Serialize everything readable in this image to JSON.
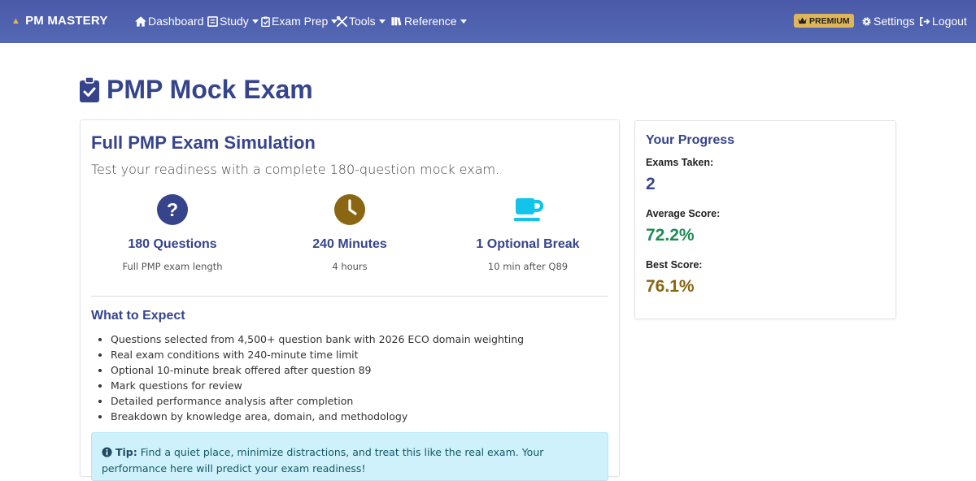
{
  "nav": {
    "brand": "PM MASTERY",
    "items": [
      {
        "label": "Dashboard",
        "icon": "home-icon",
        "dropdown": false
      },
      {
        "label": "Study",
        "icon": "book-icon",
        "dropdown": true
      },
      {
        "label": "Exam Prep",
        "icon": "clipboard-check-icon",
        "dropdown": true
      },
      {
        "label": "Tools",
        "icon": "tools-icon",
        "dropdown": true
      },
      {
        "label": "Reference",
        "icon": "books-icon",
        "dropdown": true
      }
    ],
    "premium": "PREMIUM",
    "settings": "Settings",
    "logout": "Logout"
  },
  "page": {
    "title": "PMP Mock Exam"
  },
  "main": {
    "title": "Full PMP Exam Simulation",
    "subtitle": "Test your readiness with a complete 180-question mock exam.",
    "stats": [
      {
        "icon": "question-circle-icon",
        "title": "180 Questions",
        "desc": "Full PMP exam length",
        "color": "#36448c"
      },
      {
        "icon": "clock-icon",
        "title": "240 Minutes",
        "desc": "4 hours",
        "color": "#8a6512"
      },
      {
        "icon": "coffee-icon",
        "title": "1 Optional Break",
        "desc": "10 min after Q89",
        "color": "#13c4ea"
      }
    ],
    "expect_title": "What to Expect",
    "expect_items": [
      "Questions selected from 4,500+ question bank with 2026 ECO domain weighting",
      "Real exam conditions with 240-minute time limit",
      "Optional 10-minute break offered after question 89",
      "Mark questions for review",
      "Detailed performance analysis after completion",
      "Breakdown by knowledge area, domain, and methodology"
    ],
    "tip_label": "Tip:",
    "tip_text": "Find a quiet place, minimize distractions, and treat this like the real exam. Your performance here will predict your exam readiness!"
  },
  "progress": {
    "title": "Your Progress",
    "exams_taken_label": "Exams Taken:",
    "exams_taken": "2",
    "average_label": "Average Score:",
    "average": "72.2%",
    "best_label": "Best Score:",
    "best": "76.1%"
  },
  "colors": {
    "primary": "#36448c",
    "success": "#1e8a55",
    "warning": "#8a6512",
    "info": "#13c4ea",
    "premium": "#dfb559"
  }
}
